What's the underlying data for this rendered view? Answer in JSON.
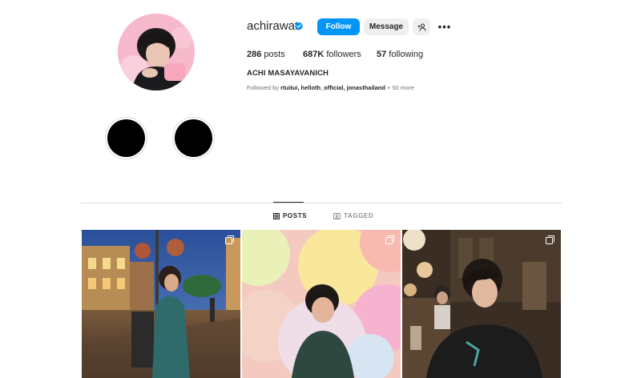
{
  "profile": {
    "username": "achirawat",
    "verified": true,
    "full_name": "ACHI MASAYAVANICH",
    "followed_by_prefix": "Followed by ",
    "followed_by_names": "rtuitui, helloth_official, jonasthailand",
    "followed_by_more": " + 50 more"
  },
  "actions": {
    "follow_label": "Follow",
    "message_label": "Message",
    "more_label": "•••"
  },
  "stats": {
    "posts_count": "286",
    "posts_label": " posts",
    "followers_count": "687K",
    "followers_label": " followers",
    "following_count": "57",
    "following_label": " following"
  },
  "highlights": [
    {
      "title": ""
    },
    {
      "title": ""
    }
  ],
  "tabs": [
    {
      "label": "POSTS",
      "active": true,
      "icon": "grid-icon"
    },
    {
      "label": "TAGGED",
      "active": false,
      "icon": "tagged-icon"
    }
  ],
  "posts": [
    {
      "type": "carousel",
      "scene": "rainy street at dusk"
    },
    {
      "type": "carousel",
      "scene": "pastel balloons"
    },
    {
      "type": "carousel",
      "scene": "restaurant interior"
    }
  ],
  "colors": {
    "accent": "#0095f6",
    "button_gray": "#efefef",
    "divider": "#dbdbdb",
    "muted_text": "#737373",
    "verified_badge": "#0095f6"
  }
}
